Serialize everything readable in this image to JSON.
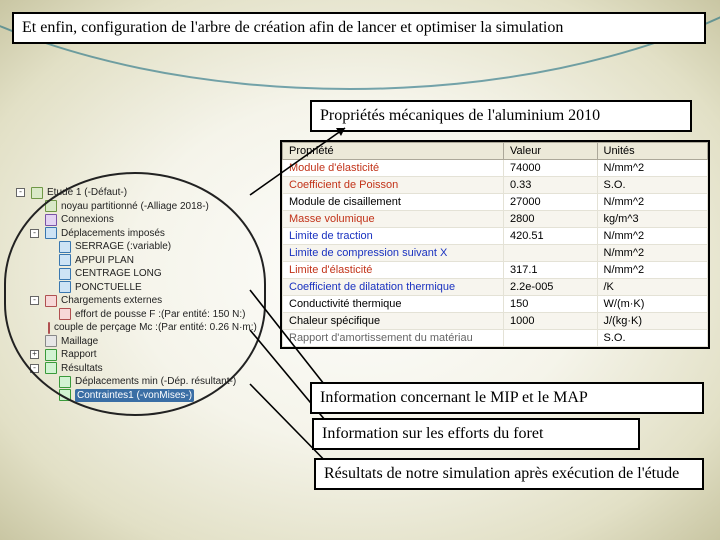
{
  "title": "Et enfin, configuration de l'arbre de création afin de lancer et optimiser  la simulation",
  "labels": {
    "aluminium": "Propriétés mécaniques de l'aluminium 2010",
    "mip": "Information concernant le MIP et le MAP",
    "efforts": "Information sur les efforts du foret",
    "resultats": "Résultats de notre simulation après exécution de l'étude"
  },
  "prop_headers": {
    "name": "Propriété",
    "value": "Valeur",
    "unit": "Unités"
  },
  "props": [
    {
      "name": "Module d'élasticité",
      "cls": "c-red",
      "value": "74000",
      "unit": "N/mm^2"
    },
    {
      "name": "Coefficient de Poisson",
      "cls": "c-red",
      "value": "0.33",
      "unit": "S.O."
    },
    {
      "name": "Module de cisaillement",
      "cls": "",
      "value": "27000",
      "unit": "N/mm^2"
    },
    {
      "name": "Masse volumique",
      "cls": "c-red",
      "value": "2800",
      "unit": "kg/m^3"
    },
    {
      "name": "Limite de traction",
      "cls": "c-blue",
      "value": "420.51",
      "unit": "N/mm^2"
    },
    {
      "name": "Limite de compression suivant X",
      "cls": "c-blue",
      "value": "",
      "unit": "N/mm^2"
    },
    {
      "name": "Limite d'élasticité",
      "cls": "c-red",
      "value": "317.1",
      "unit": "N/mm^2"
    },
    {
      "name": "Coefficient de dilatation thermique",
      "cls": "c-blue",
      "value": "2.2e-005",
      "unit": "/K"
    },
    {
      "name": "Conductivité thermique",
      "cls": "",
      "value": "150",
      "unit": "W/(m·K)"
    },
    {
      "name": "Chaleur spécifique",
      "cls": "",
      "value": "1000",
      "unit": "J/(kg·K)"
    },
    {
      "name": "Rapport d'amortissement du matériau",
      "cls": "c-gray",
      "value": "",
      "unit": "S.O."
    }
  ],
  "tree": [
    {
      "exp": "-",
      "icon": "part",
      "ind": 0,
      "label": "Etude 1 (-Défaut-)"
    },
    {
      "exp": "",
      "icon": "part",
      "ind": 1,
      "label": "noyau partitionné (-Alliage 2018-)"
    },
    {
      "exp": "",
      "icon": "conn",
      "ind": 1,
      "label": "Connexions"
    },
    {
      "exp": "-",
      "icon": "arrow",
      "ind": 1,
      "label": "Déplacements imposés"
    },
    {
      "exp": "",
      "icon": "arrow",
      "ind": 2,
      "label": "SERRAGE (:variable)"
    },
    {
      "exp": "",
      "icon": "arrow",
      "ind": 2,
      "label": "APPUI PLAN"
    },
    {
      "exp": "",
      "icon": "arrow",
      "ind": 2,
      "label": "CENTRAGE LONG"
    },
    {
      "exp": "",
      "icon": "arrow",
      "ind": 2,
      "label": "PONCTUELLE"
    },
    {
      "exp": "-",
      "icon": "load",
      "ind": 1,
      "label": "Chargements externes"
    },
    {
      "exp": "",
      "icon": "load",
      "ind": 2,
      "label": "effort de pousse F :(Par entité: 150 N:)"
    },
    {
      "exp": "",
      "icon": "load",
      "ind": 2,
      "label": "couple de perçage Mc :(Par entité: 0.26 N·m:)"
    },
    {
      "exp": "",
      "icon": "mesh",
      "ind": 1,
      "label": "Maillage"
    },
    {
      "exp": "+",
      "icon": "result",
      "ind": 1,
      "label": "Rapport"
    },
    {
      "exp": "-",
      "icon": "result",
      "ind": 1,
      "label": "Résultats"
    },
    {
      "exp": "",
      "icon": "result",
      "ind": 2,
      "label": "Déplacements min (-Dép. résultant-)"
    },
    {
      "exp": "",
      "icon": "result",
      "ind": 2,
      "label": "Contraintes1 (-vonMises-)",
      "hl": true
    }
  ]
}
